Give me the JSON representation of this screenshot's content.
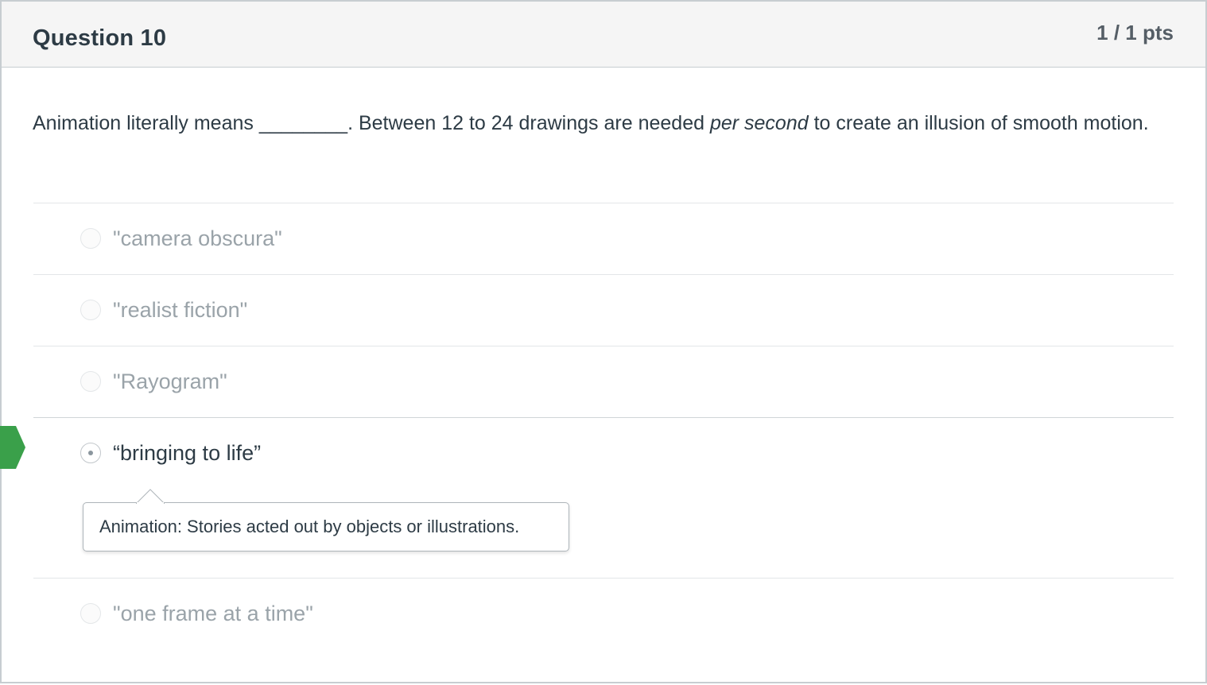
{
  "question": {
    "title": "Question 10",
    "points": "1 / 1 pts",
    "text_before_blank": "Animation literally means ________.  Between 12 to 24 drawings are needed ",
    "text_emphasis": "per second",
    "text_after": " to create an illusion of smooth motion."
  },
  "answers": [
    {
      "label": "\"camera obscura\"",
      "selected": false
    },
    {
      "label": "\"realist fiction\"",
      "selected": false
    },
    {
      "label": "\"Rayogram\"",
      "selected": false
    },
    {
      "label": "“bringing to life”",
      "selected": true
    },
    {
      "label": "\"one frame at a time\"",
      "selected": false
    }
  ],
  "feedback": {
    "text": "Animation: Stories acted out by objects or illustrations."
  },
  "colors": {
    "correct_marker": "#3aa04a",
    "header_bg": "#f5f5f5",
    "text": "#2d3b45",
    "muted_text": "#9aa3a9"
  },
  "icons": {
    "correct_marker": "correct-answer-arrow-icon",
    "radio": "radio-button-icon"
  }
}
